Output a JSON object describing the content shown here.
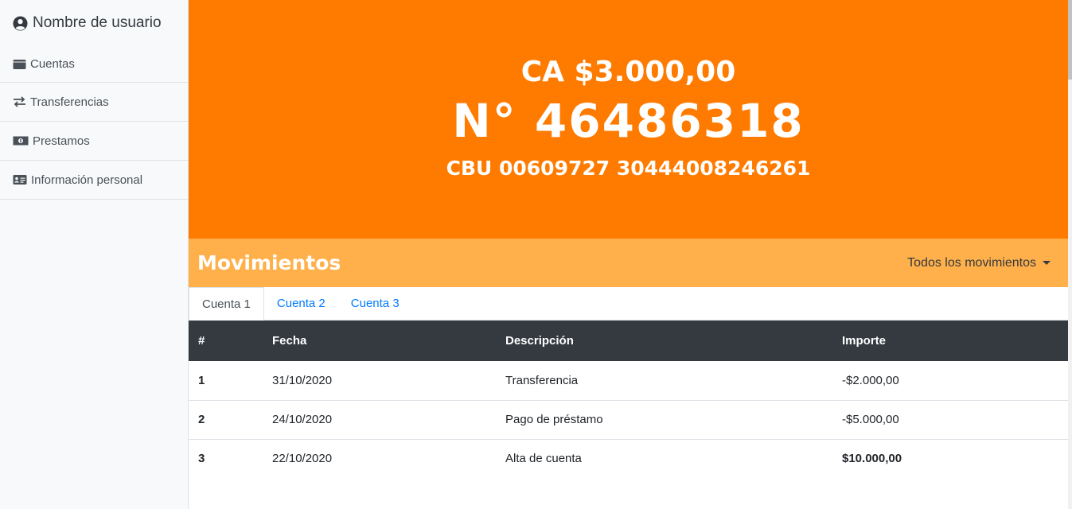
{
  "sidebar": {
    "user": "Nombre de usuario",
    "items": [
      {
        "label": "Cuentas",
        "icon": "wallet-icon"
      },
      {
        "label": "Transferencias",
        "icon": "exchange-icon"
      },
      {
        "label": "Prestamos",
        "icon": "money-bill-icon"
      },
      {
        "label": "Información personal",
        "icon": "id-card-icon"
      }
    ]
  },
  "hero": {
    "balance": "CA $3.000,00",
    "number": "N° 46486318",
    "cbu": "CBU 00609727 30444008246261",
    "bg_color": "#ff7b00"
  },
  "movements": {
    "title": "Movimientos",
    "filter_label": "Todos los movimientos",
    "header_color": "#ffb04a",
    "tabs": [
      "Cuenta 1",
      "Cuenta 2",
      "Cuenta 3"
    ],
    "active_tab": "Cuenta 1",
    "columns": [
      "#",
      "Fecha",
      "Descripción",
      "Importe"
    ],
    "rows": [
      {
        "n": "1",
        "fecha": "31/10/2020",
        "descripcion": "Transferencia",
        "importe": "-$2.000,00"
      },
      {
        "n": "2",
        "fecha": "24/10/2020",
        "descripcion": "Pago de préstamo",
        "importe": "-$5.000,00"
      },
      {
        "n": "3",
        "fecha": "22/10/2020",
        "descripcion": "Alta de cuenta",
        "importe": "$10.000,00"
      }
    ]
  }
}
